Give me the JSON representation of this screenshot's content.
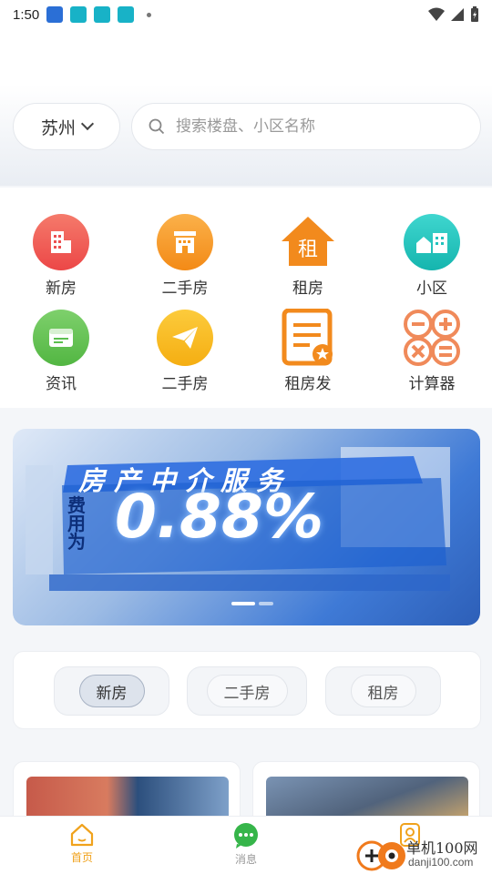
{
  "status_bar": {
    "time": "1:50"
  },
  "header": {
    "city": "苏州",
    "search_placeholder": "搜索楼盘、小区名称"
  },
  "quick_menu": [
    {
      "label": "新房",
      "icon": "building-icon",
      "color": "#f0514f"
    },
    {
      "label": "二手房",
      "icon": "house-icon",
      "color": "#f7921e"
    },
    {
      "label": "租房",
      "icon": "rent-icon",
      "color": "#f28a1d"
    },
    {
      "label": "小区",
      "icon": "community-icon",
      "color": "#22c3bd"
    },
    {
      "label": "资讯",
      "icon": "news-icon",
      "color": "#5cbf4f"
    },
    {
      "label": "二手房",
      "icon": "send-icon",
      "color": "#f6b51c"
    },
    {
      "label": "租房发",
      "icon": "rent-post-icon",
      "color": "#f28a1d"
    },
    {
      "label": "计算器",
      "icon": "calculator-icon",
      "color": "#f08a5a"
    }
  ],
  "banner": {
    "title": "房产中介服务",
    "fee_label": "费用为",
    "rate": "0.88%"
  },
  "listing_tabs": {
    "items": [
      "新房",
      "二手房",
      "租房"
    ],
    "active": "新房"
  },
  "bottom_nav": [
    {
      "label": "首页",
      "icon": "home-icon",
      "active": true
    },
    {
      "label": "消息",
      "icon": "chat-icon",
      "active": false
    }
  ],
  "watermark": {
    "text": "单机100网",
    "url_text": "danji100.com"
  },
  "colors": {
    "accent": "#f0a21c",
    "nav_active": "#f0a21c",
    "nav_inactive": "#999999"
  }
}
